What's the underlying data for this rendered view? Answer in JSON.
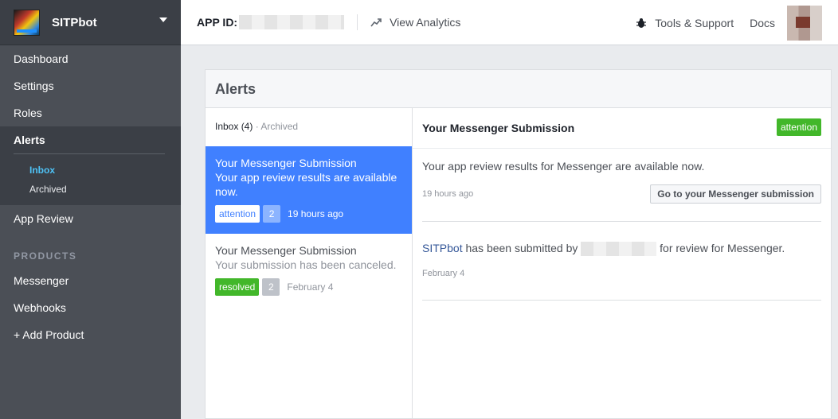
{
  "sidebar": {
    "app_name": "SITPbot",
    "nav": [
      {
        "label": "Dashboard"
      },
      {
        "label": "Settings"
      },
      {
        "label": "Roles"
      },
      {
        "label": "Alerts"
      }
    ],
    "alerts_sub": [
      {
        "label": "Inbox"
      },
      {
        "label": "Archived"
      }
    ],
    "app_review": "App Review",
    "products_heading": "PRODUCTS",
    "products": [
      {
        "label": "Messenger"
      },
      {
        "label": "Webhooks"
      },
      {
        "label": "+ Add Product"
      }
    ]
  },
  "topbar": {
    "app_id_label": "APP ID:",
    "analytics": "View Analytics",
    "tools": "Tools & Support",
    "docs": "Docs"
  },
  "alerts": {
    "title": "Alerts",
    "tab_inbox": "Inbox (4)",
    "tab_sep": " · ",
    "tab_archived": "Archived",
    "items": [
      {
        "title": "Your Messenger Submission",
        "subtitle": "Your app review results are available now.",
        "status": "attention",
        "count": "2",
        "time": "19 hours ago"
      },
      {
        "title": "Your Messenger Submission",
        "subtitle": "Your submission has been canceled.",
        "status": "resolved",
        "count": "2",
        "time": "February 4"
      }
    ]
  },
  "detail": {
    "title": "Your Messenger Submission",
    "status": "attention",
    "messages": [
      {
        "text": "Your app review results for Messenger are available now.",
        "time": "19 hours ago",
        "button": "Go to your Messenger submission"
      },
      {
        "link": "SITPbot",
        "text_a": " has been submitted by ",
        "text_b": " for review for Messenger.",
        "time": "February 4"
      }
    ]
  },
  "colors": {
    "sidebar_bg": "#4b4f56",
    "selected_bg": "#4080ff",
    "attention": "#42b72a",
    "inbox_accent": "#4ec3f7"
  }
}
